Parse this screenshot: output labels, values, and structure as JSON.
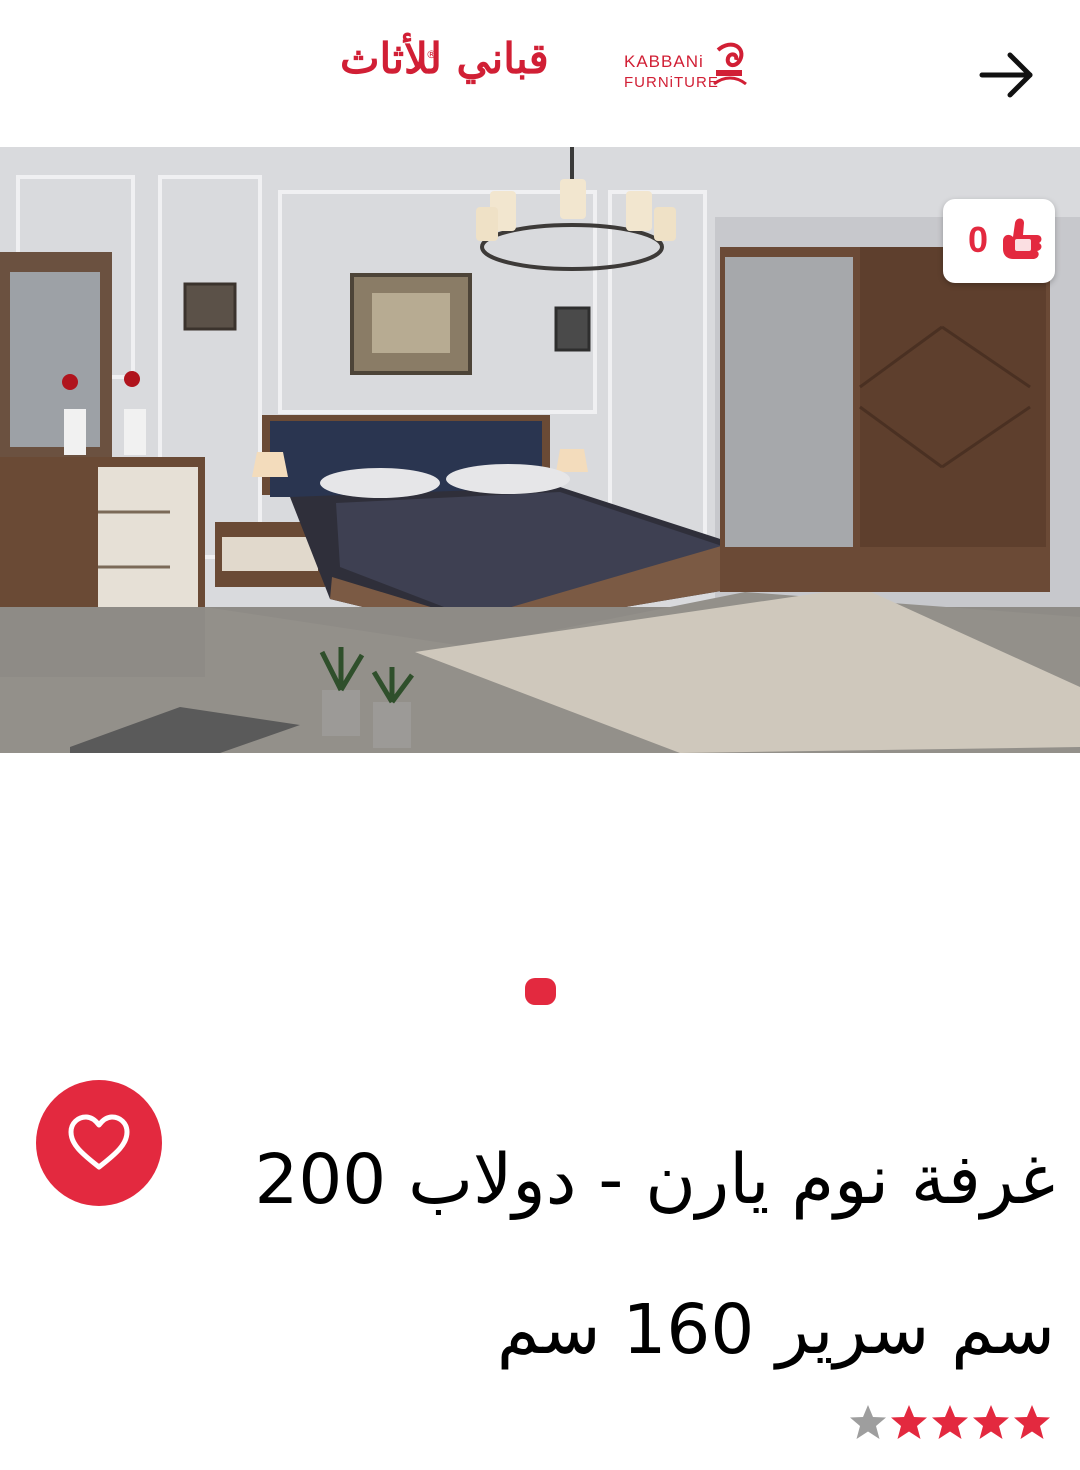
{
  "header": {
    "logo": {
      "arabic_text": "قباني للأثاث",
      "english_line1": "KABBANi",
      "english_line2": "FURNiTURE",
      "registered": "®"
    },
    "back_icon": "arrow-right-icon"
  },
  "hero": {
    "image_name": "bedroom-set-photo",
    "alt": "غرفة نوم يارن"
  },
  "cart": {
    "count": "0",
    "icon": "thumbs-up-cart-icon"
  },
  "pager": {
    "total_pages": 1,
    "active_index": 0
  },
  "product": {
    "title": "غرفة نوم يارن - دولاب 200 سم سرير 160 سم",
    "rating": 4,
    "max_rating": 5,
    "favorite_icon": "heart-icon"
  },
  "colors": {
    "accent": "#e3293f",
    "brand": "#d11f35",
    "star_on": "#e3293f",
    "star_off": "#9e9e9e"
  }
}
